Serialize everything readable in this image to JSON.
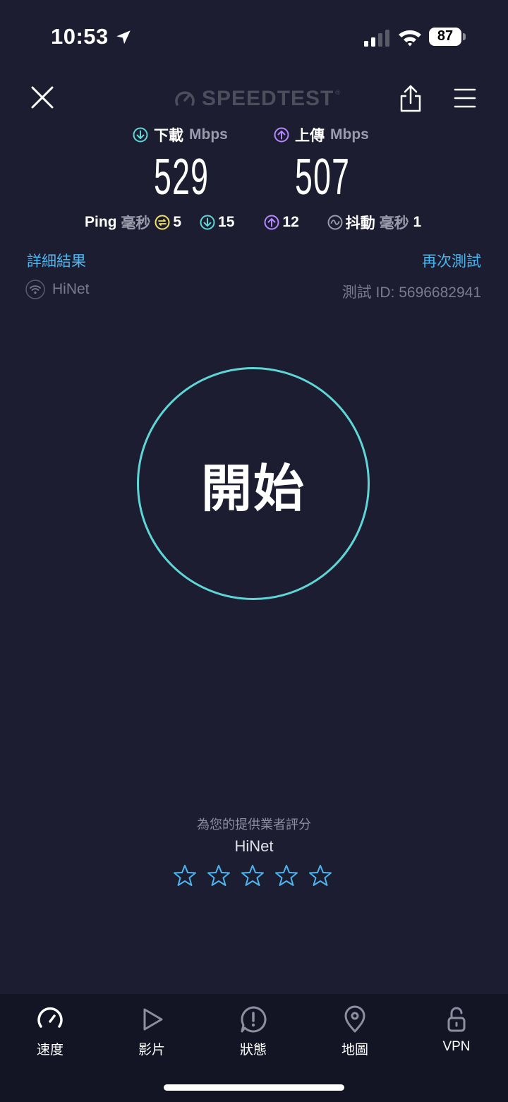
{
  "status_bar": {
    "time": "10:53",
    "battery": "87"
  },
  "header": {
    "logo_text": "SPEEDTEST",
    "logo_tm": "®"
  },
  "results": {
    "download_label": "下載",
    "upload_label": "上傳",
    "unit": "Mbps",
    "download_value": "529",
    "upload_value": "507"
  },
  "ping": {
    "label": "Ping",
    "unit": "毫秒",
    "idle": "5",
    "download": "15",
    "upload": "12",
    "jitter_label": "抖動",
    "jitter_unit": "毫秒",
    "jitter": "1"
  },
  "links": {
    "details": "詳細結果",
    "retry": "再次測試"
  },
  "provider": {
    "name": "HiNet",
    "test_id": "測試 ID: 5696682941"
  },
  "start_button": {
    "label": "開始"
  },
  "rating": {
    "title": "為您的提供業者評分",
    "isp": "HiNet",
    "star_count": 5
  },
  "tabbar": {
    "items": [
      {
        "label": "速度",
        "icon": "speedometer-icon"
      },
      {
        "label": "影片",
        "icon": "play-icon"
      },
      {
        "label": "狀態",
        "icon": "alert-icon"
      },
      {
        "label": "地圖",
        "icon": "map-pin-icon"
      },
      {
        "label": "VPN",
        "icon": "lock-open-icon"
      }
    ]
  },
  "colors": {
    "background": "#1c1d30",
    "accent_link": "#4db6f0",
    "download": "#5fd6d6",
    "upload": "#b388ff",
    "start_ring": "#5fd6d6"
  }
}
